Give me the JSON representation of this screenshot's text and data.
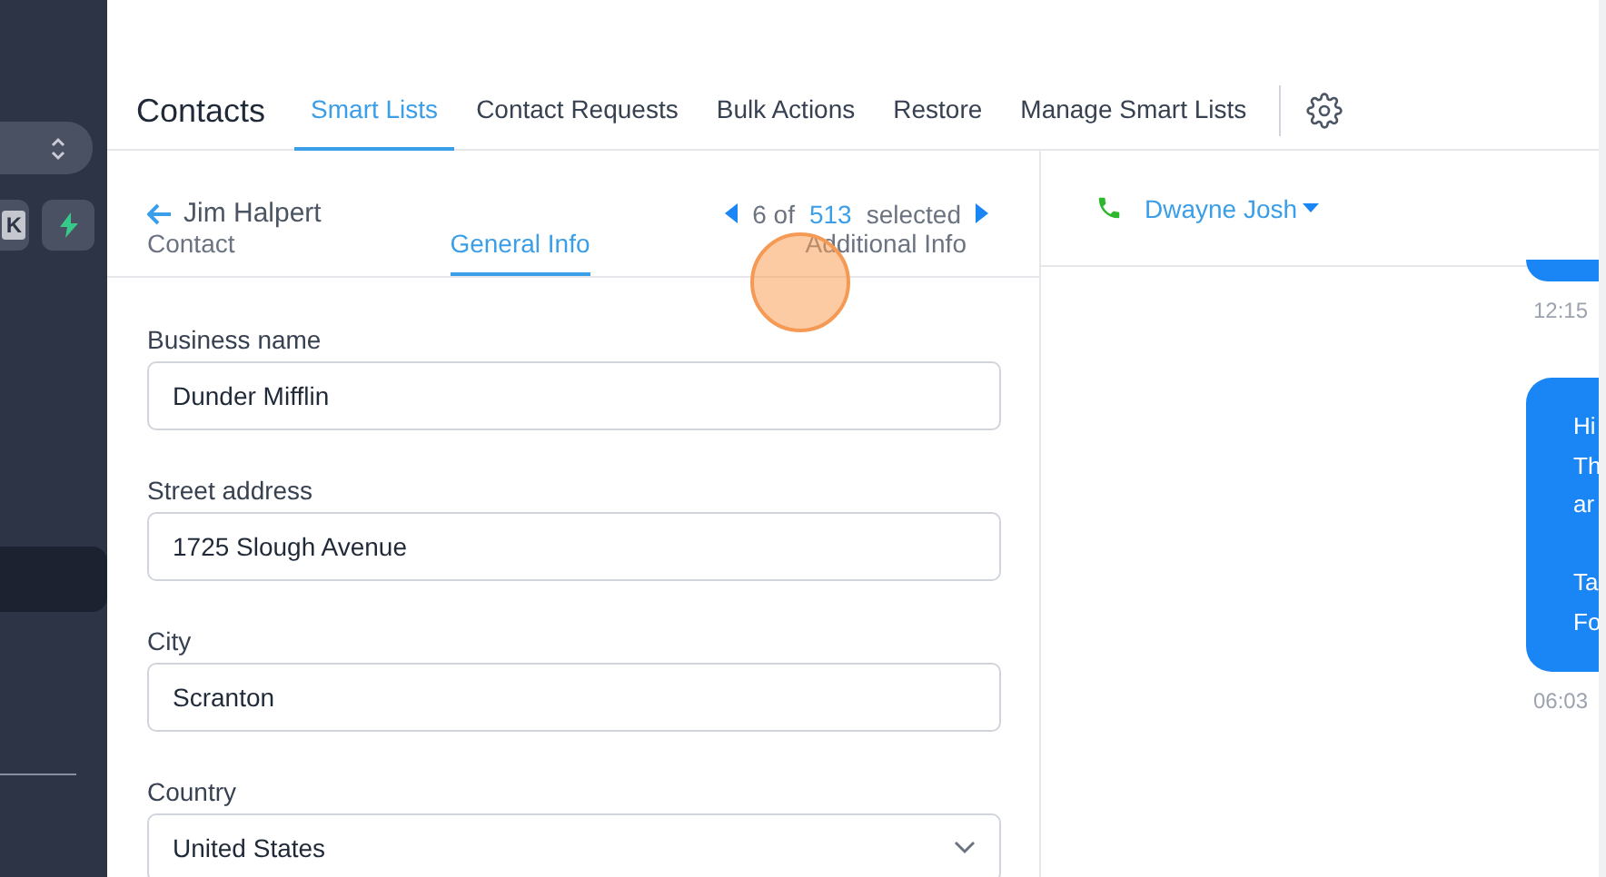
{
  "sidebar": {
    "shortcut_key": "K"
  },
  "header": {
    "title": "Contacts",
    "tabs": [
      {
        "label": "Smart Lists",
        "selected": true
      },
      {
        "label": "Contact Requests",
        "selected": false
      },
      {
        "label": "Bulk Actions",
        "selected": false
      },
      {
        "label": "Restore",
        "selected": false
      },
      {
        "label": "Manage Smart Lists",
        "selected": false
      }
    ]
  },
  "contact": {
    "name": "Jim Halpert",
    "pager": {
      "index": "6 of",
      "total": "513",
      "suffix": "selected"
    },
    "tabs": [
      {
        "label": "Contact",
        "selected": false
      },
      {
        "label": "General Info",
        "selected": true
      },
      {
        "label": "Additional Info",
        "selected": false
      }
    ],
    "fields": [
      {
        "label": "Business name",
        "value": "Dunder Mifflin",
        "kind": "text"
      },
      {
        "label": "Street address",
        "value": "1725 Slough Avenue",
        "kind": "text"
      },
      {
        "label": "City",
        "value": "Scranton",
        "kind": "text"
      },
      {
        "label": "Country",
        "value": "United States",
        "kind": "select"
      }
    ]
  },
  "conversation": {
    "recipient": "Dwayne Josh",
    "messages": [
      {
        "kind": "partial",
        "time": "12:15"
      },
      {
        "kind": "full",
        "paragraphs": [
          [
            "Hi",
            "Th",
            "ar"
          ],
          [
            "Ta",
            "Fo"
          ]
        ],
        "time": "06:03"
      }
    ]
  }
}
